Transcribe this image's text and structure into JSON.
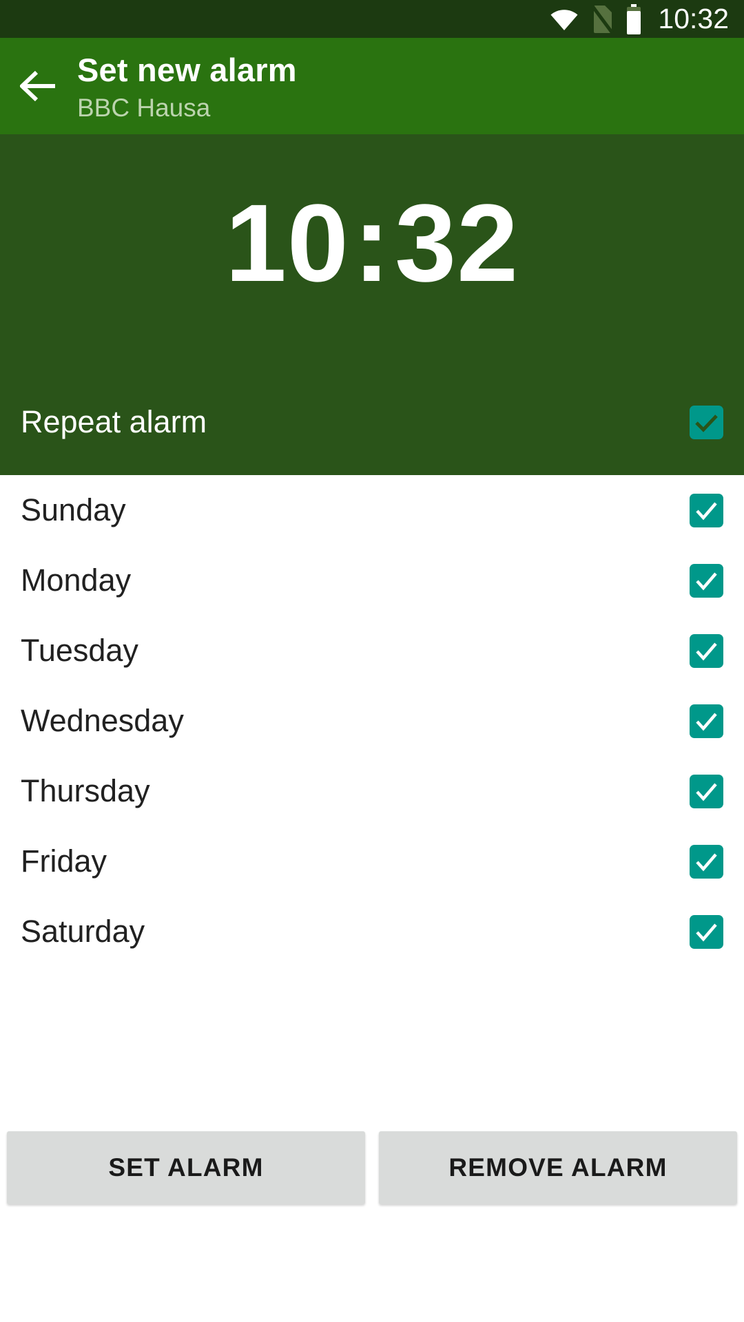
{
  "status_bar": {
    "time": "10:32",
    "icons": [
      {
        "name": "wifi-icon",
        "state": "connected"
      },
      {
        "name": "no-sim-card-icon",
        "state": "absent"
      },
      {
        "name": "battery-icon",
        "state": "charged"
      }
    ],
    "background_color": "#1c3a11"
  },
  "app_bar": {
    "back_label": "back-arrow-icon",
    "title": "Set new alarm",
    "subtitle": "BBC Hausa",
    "background_color": "#2a7310",
    "title_color": "#ffffff",
    "subtitle_color": "#bcd4ae"
  },
  "time_panel": {
    "hours": "10",
    "separator": ":",
    "minutes": "32",
    "background_color": "#2a5419",
    "repeat": {
      "label": "Repeat alarm",
      "checked": true
    }
  },
  "days": [
    {
      "label": "Sunday",
      "checked": true
    },
    {
      "label": "Monday",
      "checked": true
    },
    {
      "label": "Tuesday",
      "checked": true
    },
    {
      "label": "Wednesday",
      "checked": true
    },
    {
      "label": "Thursday",
      "checked": true
    },
    {
      "label": "Friday",
      "checked": true
    },
    {
      "label": "Saturday",
      "checked": true
    }
  ],
  "buttons": {
    "set_alarm": "SET ALARM",
    "remove_alarm": "REMOVE ALARM",
    "background_color": "#d9dbda"
  },
  "colors": {
    "accent_teal": "#00988a",
    "dark_green": "#2a5419",
    "app_bar_green": "#2a7310",
    "status_bar_green": "#1c3a11"
  }
}
